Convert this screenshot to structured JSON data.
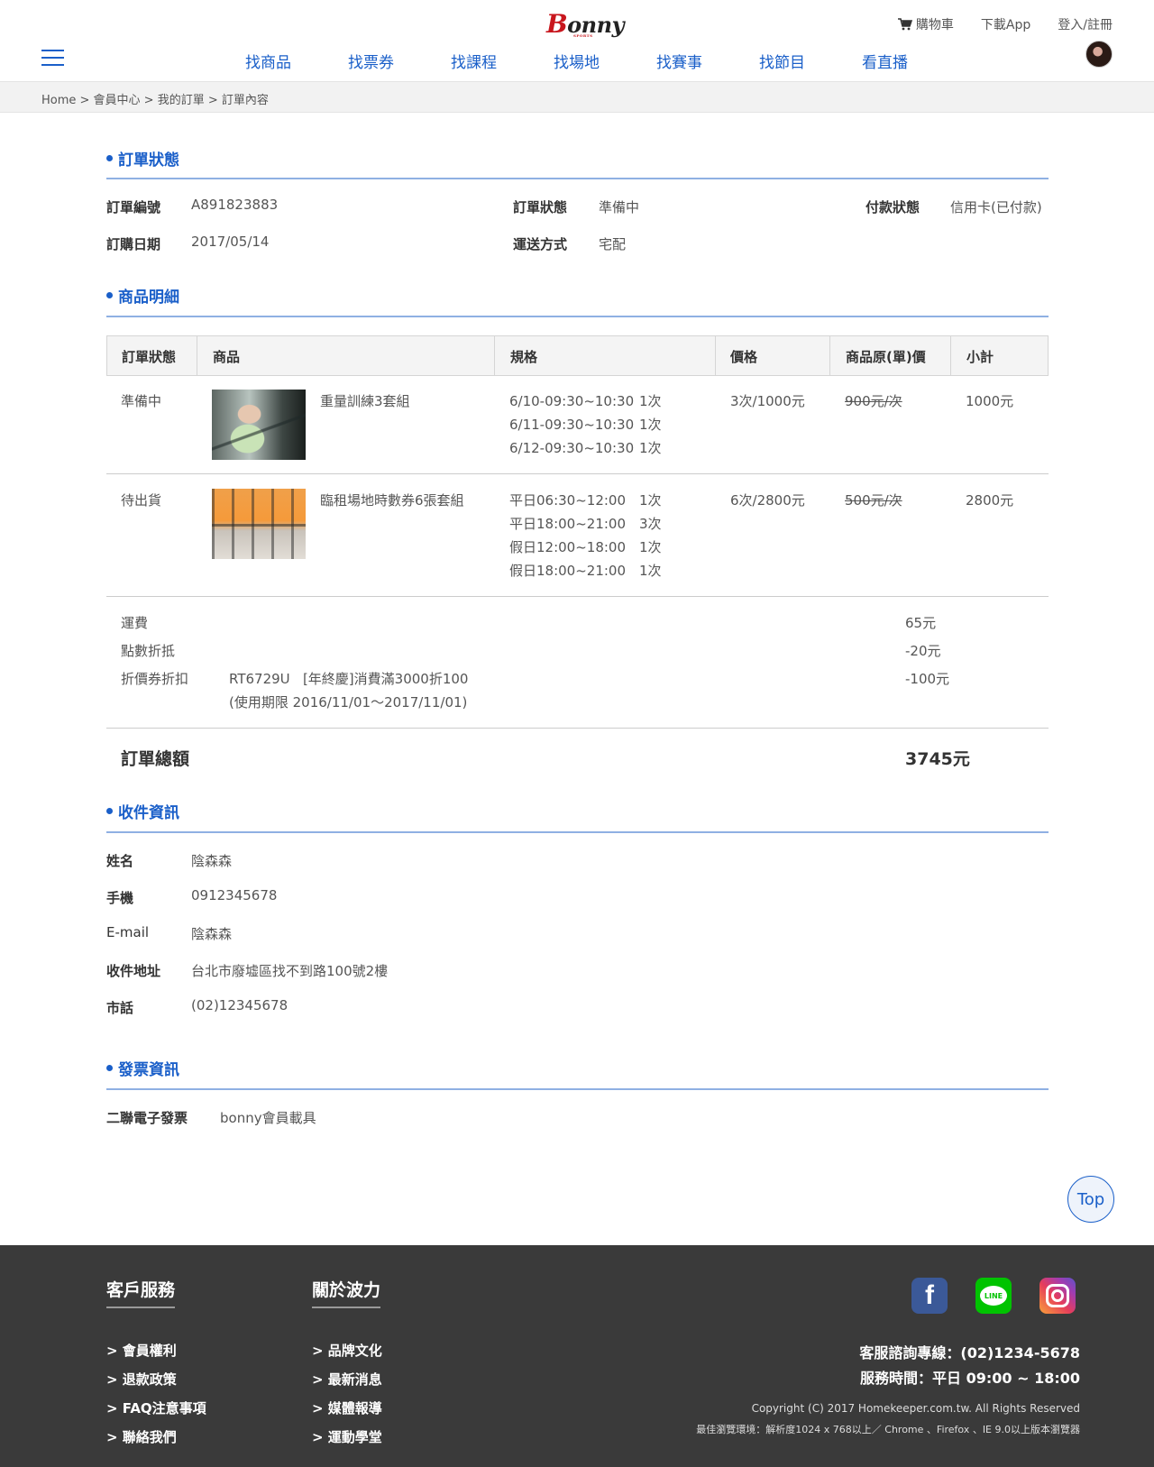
{
  "header": {
    "logo_main": "onny",
    "logo_letter": "B",
    "logo_sub": "SPORTS",
    "cart_label": "購物車",
    "download_label": "下載App",
    "login_label": "登入/註冊",
    "nav": [
      "找商品",
      "找票券",
      "找課程",
      "找場地",
      "找賽事",
      "找節目",
      "看直播"
    ]
  },
  "breadcrumb": "Home > 會員中心 > 我的訂單 > 訂單內容",
  "order_status": {
    "title": "訂單狀態",
    "order_no_label": "訂單編號",
    "order_no": "A891823883",
    "status_label": "訂單狀態",
    "status": "準備中",
    "payment_label": "付款狀態",
    "payment": "信用卡(已付款)",
    "date_label": "訂購日期",
    "date": "2017/05/14",
    "shipping_label": "運送方式",
    "shipping": "宅配"
  },
  "items": {
    "title": "商品明細",
    "headers": [
      "訂單狀態",
      "商品",
      "規格",
      "價格",
      "商品原(單)價",
      "小計"
    ],
    "rows": [
      {
        "status": "準備中",
        "name": "重量訓練3套組",
        "specs": [
          "6/10-09:30~10:30",
          "6/11-09:30~10:30",
          "6/12-09:30~10:30"
        ],
        "qty": [
          "1次",
          "1次",
          "1次"
        ],
        "price": "3次/1000元",
        "original": "900元/次",
        "subtotal": "1000元"
      },
      {
        "status": "待出貨",
        "name": "臨租場地時數券6張套組",
        "specs": [
          "平日06:30~12:00",
          "平日18:00~21:00",
          "假日12:00~18:00",
          "假日18:00~21:00"
        ],
        "qty": [
          "1次",
          "3次",
          "1次",
          "1次"
        ],
        "price": "6次/2800元",
        "original": "500元/次",
        "subtotal": "2800元"
      }
    ],
    "shipping_fee_label": "運費",
    "shipping_fee": "65元",
    "points_label": "點數折抵",
    "points": "-20元",
    "coupon_label": "折價券折扣",
    "coupon_desc": "RT6729U   [年終慶]消費滿3000折100",
    "coupon_period": "(使用期限 2016/11/01～2017/11/01)",
    "coupon": "-100元",
    "total_label": "訂單總額",
    "total": "3745元"
  },
  "recipient": {
    "title": "收件資訊",
    "name_label": "姓名",
    "name": "陰森森",
    "mobile_label": "手機",
    "mobile": "0912345678",
    "email_label": "E-mail",
    "email": "陰森森",
    "address_label": "收件地址",
    "address": "台北市廢墟區找不到路100號2樓",
    "phone_label": "市話",
    "phone": "(02)12345678"
  },
  "invoice": {
    "title": "發票資訊",
    "type_label": "二聯電子發票",
    "type": "bonny會員載具"
  },
  "top_button": "Top",
  "footer": {
    "col1_title": "客戶服務",
    "col1_links": [
      "> 會員權利",
      "> 退款政策",
      "> FAQ注意事項",
      "> 聯絡我們"
    ],
    "col2_title": "關於波力",
    "col2_links": [
      "> 品牌文化",
      "> 最新消息",
      "> 媒體報導",
      "> 運動學堂"
    ],
    "hotline": "客服諮詢專線：(02)1234-5678",
    "hours": "服務時間：平日 09:00 ~ 18:00",
    "copyright": "Copyright (C) 2017 Homekeeper.com.tw. All Rights Reserved",
    "browsers": "最佳瀏覽環境：解析度1024 x 768以上／ Chrome 、Firefox 、IE 9.0以上版本瀏覽器",
    "fb_glyph": "f",
    "line_glyph": "LINE"
  },
  "colors": {
    "accent": "#1a5fc9",
    "footer_bg": "#3a3a3a",
    "logo_red": "#c8161d"
  }
}
